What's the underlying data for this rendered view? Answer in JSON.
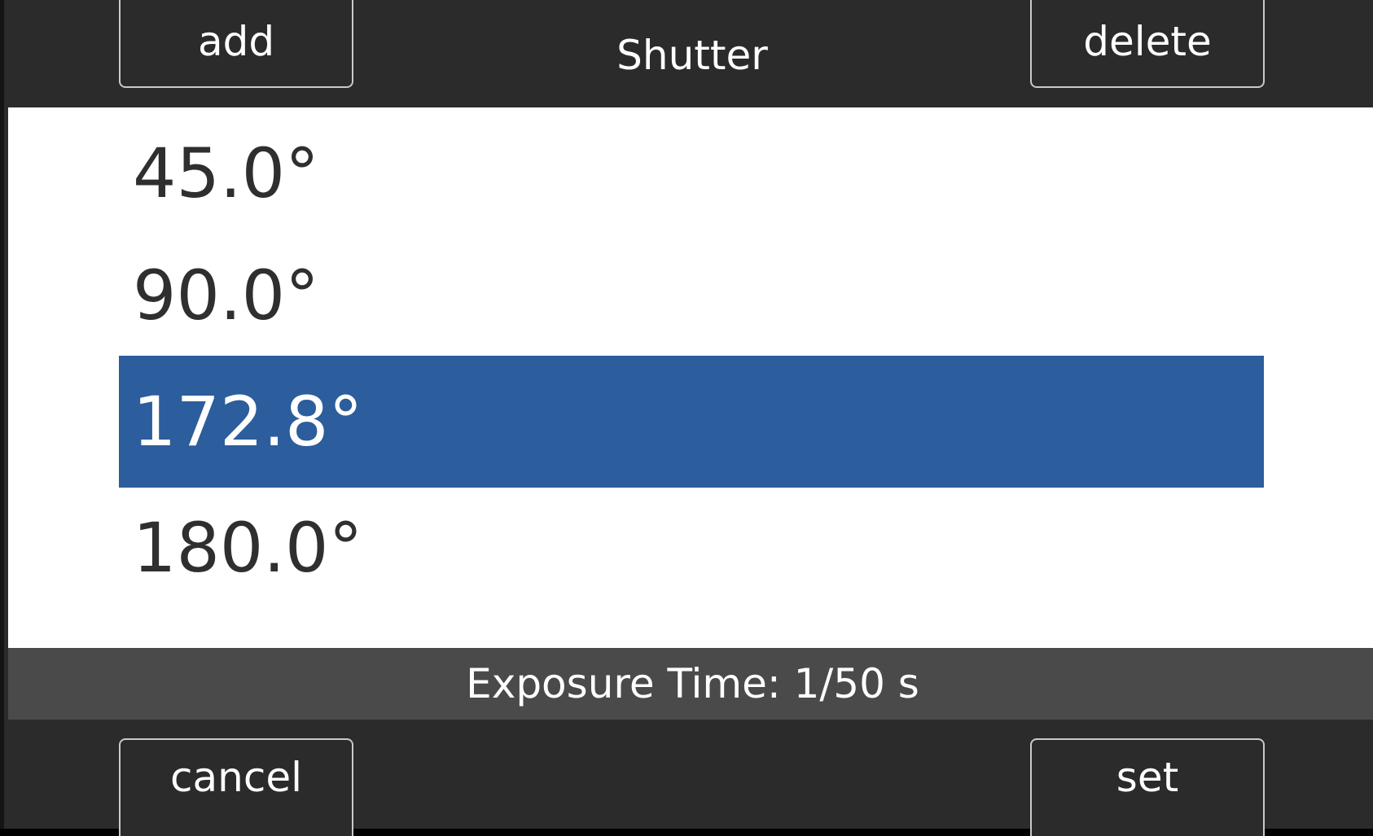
{
  "header": {
    "title": "Shutter",
    "add_label": "add",
    "delete_label": "delete"
  },
  "list": {
    "items": [
      {
        "label": "45.0°"
      },
      {
        "label": "90.0°"
      },
      {
        "label": "172.8°",
        "selected": true
      },
      {
        "label": "180.0°"
      }
    ]
  },
  "status": {
    "text": "Exposure Time: 1/50 s"
  },
  "footer": {
    "cancel_label": "cancel",
    "set_label": "set"
  },
  "colors": {
    "background": "#2b2b2b",
    "list_background": "#ffffff",
    "selection": "#2c5d9c",
    "status_bar": "#4a4a4a"
  }
}
